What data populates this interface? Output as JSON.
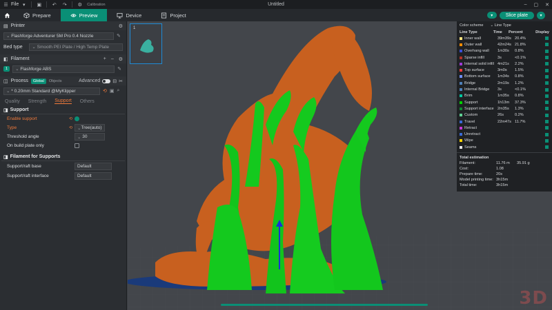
{
  "titlebar": {
    "menu_label": "File",
    "calibration_label": "Calibration",
    "title": "Untitled"
  },
  "tabs": [
    {
      "label": "Prepare",
      "icon": "cube-icon"
    },
    {
      "label": "Preview",
      "icon": "eye-icon",
      "active": true
    },
    {
      "label": "Device",
      "icon": "monitor-icon"
    },
    {
      "label": "Project",
      "icon": "project-icon"
    }
  ],
  "actions": {
    "slice_label": "Slice plate"
  },
  "printer": {
    "section_label": "Printer",
    "name": "Flashforge Adventurer 5M Pro 0.4 Nozzle",
    "bed_type_label": "Bed type",
    "bed_type_value": "Smooth PEI Plate / High Temp Plate"
  },
  "filament": {
    "section_label": "Filament",
    "slot": "1",
    "name": "Flashforge ABS"
  },
  "process": {
    "section_label": "Process",
    "global_label": "Global",
    "objects_label": "Objects",
    "advanced_label": "Advanced",
    "preset": "* 0.20mm Standard @MyKlipper",
    "subtabs": [
      "Quality",
      "Strength",
      "Support",
      "Others"
    ],
    "active_subtab": "Support"
  },
  "support": {
    "group_label": "Support",
    "enable_label": "Enable support",
    "type_label": "Type",
    "type_value": "Tree(auto)",
    "threshold_label": "Threshold angle",
    "threshold_value": "30",
    "on_build_plate_label": "On build plate only"
  },
  "filament_supports": {
    "group_label": "Filament for Supports",
    "base_label": "Support/raft base",
    "base_value": "Default",
    "interface_label": "Support/raft interface",
    "interface_value": "Default"
  },
  "plate_thumb": {
    "number": "1"
  },
  "legend": {
    "color_scheme_label": "Color scheme",
    "scheme_value": "Line Type",
    "columns": [
      "Line Type",
      "Time",
      "Percent",
      "Display"
    ],
    "rows": [
      {
        "name": "Inner wall",
        "time": "39m39s",
        "percent": "20.4%",
        "color": "#ffe680"
      },
      {
        "name": "Outer wall",
        "time": "42m24s",
        "percent": "21.8%",
        "color": "#ff8c00"
      },
      {
        "name": "Overhang wall",
        "time": "1m30s",
        "percent": "0.8%",
        "color": "#3a4fd6"
      },
      {
        "name": "Sparse infill",
        "time": "3s",
        "percent": "<0.1%",
        "color": "#b03029"
      },
      {
        "name": "Internal solid infill",
        "time": "4m21s",
        "percent": "2.2%",
        "color": "#9c3ad6"
      },
      {
        "name": "Top surface",
        "time": "3m0s",
        "percent": "1.5%",
        "color": "#f23c3c"
      },
      {
        "name": "Bottom surface",
        "time": "1m34s",
        "percent": "0.8%",
        "color": "#6f8fff"
      },
      {
        "name": "Bridge",
        "time": "2m19s",
        "percent": "1.2%",
        "color": "#4d80ba"
      },
      {
        "name": "Internal Bridge",
        "time": "3s",
        "percent": "<0.1%",
        "color": "#4d80ba"
      },
      {
        "name": "Brim",
        "time": "1m35s",
        "percent": "0.8%",
        "color": "#00c7a0"
      },
      {
        "name": "Support",
        "time": "1h13m",
        "percent": "37.3%",
        "color": "#00d400"
      },
      {
        "name": "Support interface",
        "time": "2m35s",
        "percent": "1.3%",
        "color": "#0f8a30"
      },
      {
        "name": "Custom",
        "time": "26s",
        "percent": "0.2%",
        "color": "#5ed194"
      },
      {
        "name": "Travel",
        "time": "22m47s",
        "percent": "11.7%",
        "color": "#3a6ad6"
      },
      {
        "name": "Retract",
        "time": "",
        "percent": "",
        "color": "#c637d6"
      },
      {
        "name": "Unretract",
        "time": "",
        "percent": "",
        "color": "#3a6ad6"
      },
      {
        "name": "Wipe",
        "time": "",
        "percent": "",
        "color": "#ffd400"
      },
      {
        "name": "Seams",
        "time": "",
        "percent": "",
        "color": "#e6e6e6"
      }
    ],
    "estimation_label": "Total estimation",
    "estimation": [
      {
        "k": "Filament:",
        "v": "11.76 m",
        "v2": "35.91 g"
      },
      {
        "k": "Cost:",
        "v": "1.08",
        "v2": ""
      },
      {
        "k": "Prepare time:",
        "v": "20s",
        "v2": ""
      },
      {
        "k": "Model printing time:",
        "v": "3h15m",
        "v2": ""
      },
      {
        "k": "Total time:",
        "v": "3h15m",
        "v2": ""
      }
    ]
  },
  "watermark": "3D"
}
